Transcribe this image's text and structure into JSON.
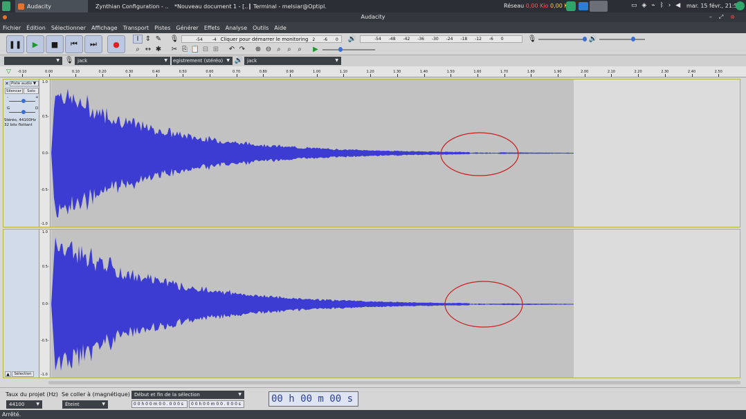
{
  "taskbar": {
    "tasks": [
      "Audacity",
      "Zynthian Configuration - ...",
      "*Nouveau document 1 - [...",
      "Terminal - melsiar@Optipl..."
    ],
    "network_label": "Réseau",
    "net_down": "0,00 Kio",
    "net_up": "0,00 Kio",
    "clock": "mar. 15 févr., 21:50"
  },
  "window": {
    "title": "Audacity"
  },
  "menu": [
    "Fichier",
    "Édition",
    "Sélectionner",
    "Affichage",
    "Transport",
    "Pistes",
    "Générer",
    "Effets",
    "Analyse",
    "Outils",
    "Aide"
  ],
  "meters": {
    "record_ticks": [
      "-54",
      "-4",
      "Cliquer pour démarrer le monitoring",
      "2",
      "-6",
      "0"
    ],
    "play_ticks": [
      "-54",
      "-48",
      "-42",
      "-36",
      "-30",
      "-24",
      "-18",
      "-12",
      "-6",
      "0"
    ]
  },
  "devices": {
    "host": "",
    "record_device": "jack",
    "channels": "egistrement (stéréo)",
    "playback_device": "jack"
  },
  "ruler": {
    "ticks": [
      "-0.10",
      "0.00",
      "0.10",
      "0.20",
      "0.30",
      "0.40",
      "0.50",
      "0.60",
      "0.70",
      "0.80",
      "0.90",
      "1.00",
      "1.10",
      "1.20",
      "1.30",
      "1.40",
      "1.50",
      "1.60",
      "1.70",
      "1.80",
      "1.90",
      "2.00",
      "2.10",
      "2.20",
      "2.30",
      "2.40",
      "2.50"
    ]
  },
  "track": {
    "name": "Piste audio",
    "mute": "Silencer",
    "solo": "Solo",
    "gain_minus": "-",
    "gain_plus": "+",
    "pan_left": "G",
    "pan_right": "D",
    "info_line1": "Stéréo, 44100Hz",
    "info_line2": "32 bits flottant",
    "select": "Sélection",
    "scale": [
      "1.0",
      "0.5-",
      "0.0-",
      "-0.5-",
      "-1.0"
    ]
  },
  "bottom": {
    "rate_label": "Taux du projet (Hz)",
    "rate_value": "44100",
    "snap_label": "Se coller à (magnétique)",
    "snap_value": "Éteint",
    "selection_mode": "Début et fin de la sélection",
    "sel_start": "0 0 h 0 0 m 0 0 . 0 0 0 s",
    "sel_end": "0 0 h 0 0 m 0 0 . 0 0 0 s",
    "time": "00 h 00 m 00 s"
  },
  "status": "Arrêté.",
  "colors": {
    "waveform": "#3c3cd2",
    "accent": "#bcc7e0",
    "annotation": "#c81e1e"
  }
}
